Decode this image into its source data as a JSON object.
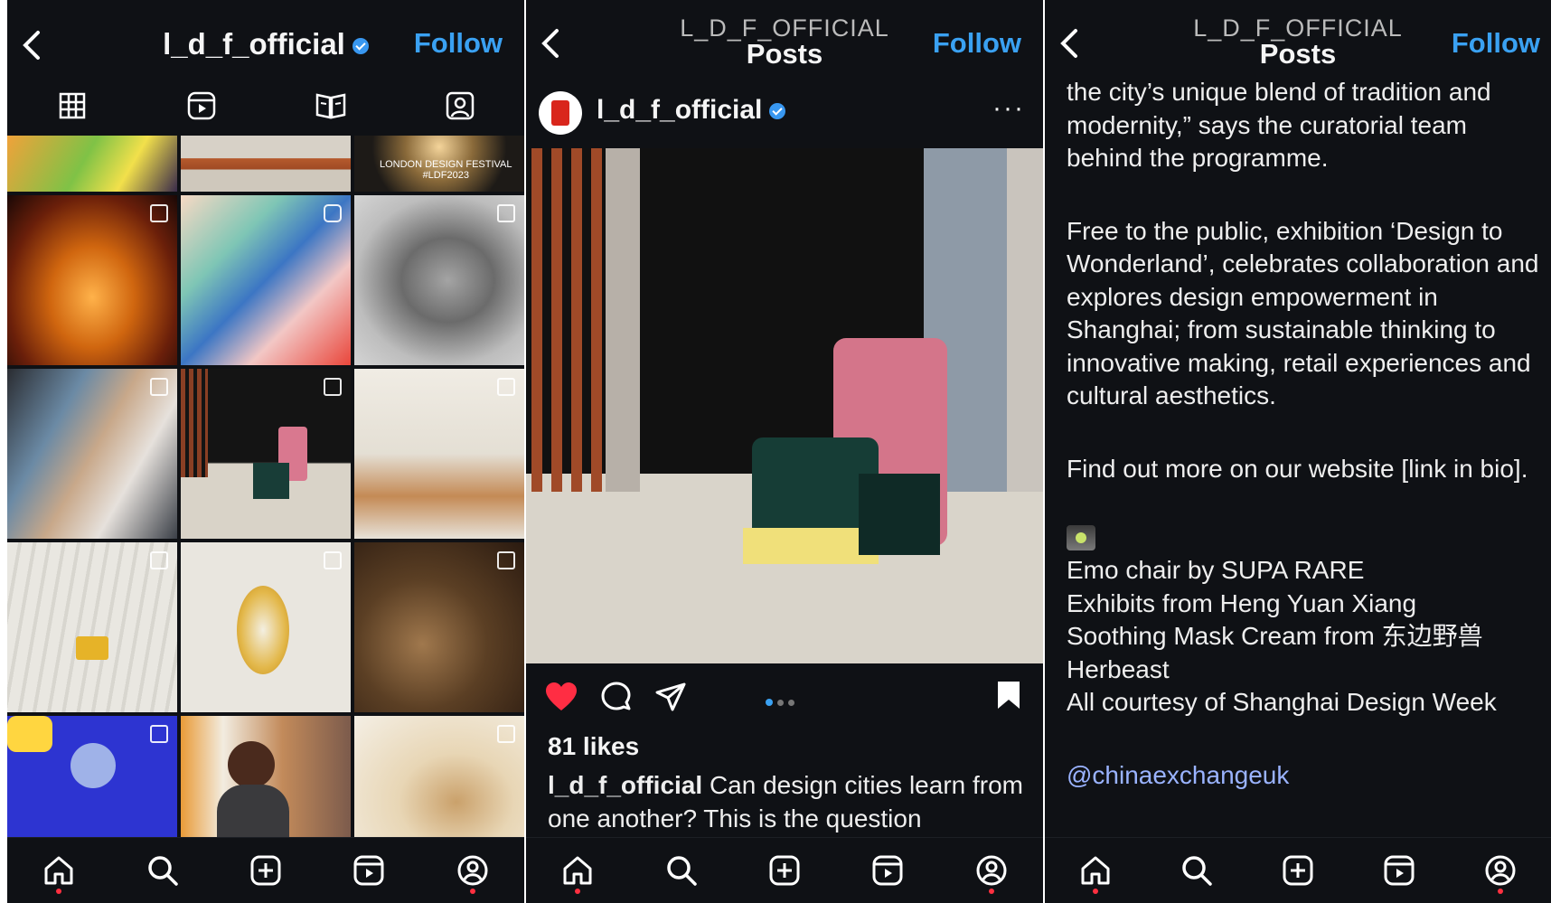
{
  "panel1": {
    "header": {
      "title": "l_d_f_official",
      "follow_label": "Follow"
    },
    "tabs": [
      {
        "icon": "grid-icon"
      },
      {
        "icon": "reels-icon"
      },
      {
        "icon": "guides-icon"
      },
      {
        "icon": "tagged-icon"
      }
    ],
    "grid_cell_text": "LONDON DESIGN FESTIVAL\n#LDF2023"
  },
  "panel2": {
    "header": {
      "subtitle": "L_D_F_OFFICIAL",
      "title": "Posts",
      "follow_label": "Follow"
    },
    "author": {
      "name": "l_d_f_official",
      "more": "···"
    },
    "likes": "81 likes",
    "caption": {
      "username": "l_d_f_official",
      "text": " Can design cities learn from one another? This is the question"
    },
    "carousel": {
      "count": 3,
      "active": 0
    }
  },
  "panel3": {
    "header": {
      "subtitle": "L_D_F_OFFICIAL",
      "title": "Posts",
      "follow_label": "Follow"
    },
    "para1": "the city’s unique blend of tradition and modernity,” says the curatorial team behind the programme.",
    "para2": "Free to the public, exhibition ‘Design to Wonderland’, celebrates collaboration and explores design empowerment in Shanghai; from sustainable thinking to innovative making, retail experiences and cultural aesthetics.",
    "para3": "Find out more on our website [link in bio].",
    "credits": [
      "Emo chair by SUPA RARE",
      "Exhibits from Heng Yuan Xiang",
      "Soothing Mask Cream from 东边野兽 Herbeast",
      "All courtesy of Shanghai Design Week"
    ],
    "mention": "@chinaexchangeuk"
  },
  "colors": {
    "background": "#0f1115",
    "follow": "#3aa1f2",
    "like": "#ff2d43",
    "text": "#f5f5f5"
  },
  "bottom_nav": [
    {
      "icon": "home-icon",
      "active": true
    },
    {
      "icon": "search-icon"
    },
    {
      "icon": "create-icon"
    },
    {
      "icon": "reels-icon"
    },
    {
      "icon": "profile-icon",
      "badge": true
    }
  ]
}
